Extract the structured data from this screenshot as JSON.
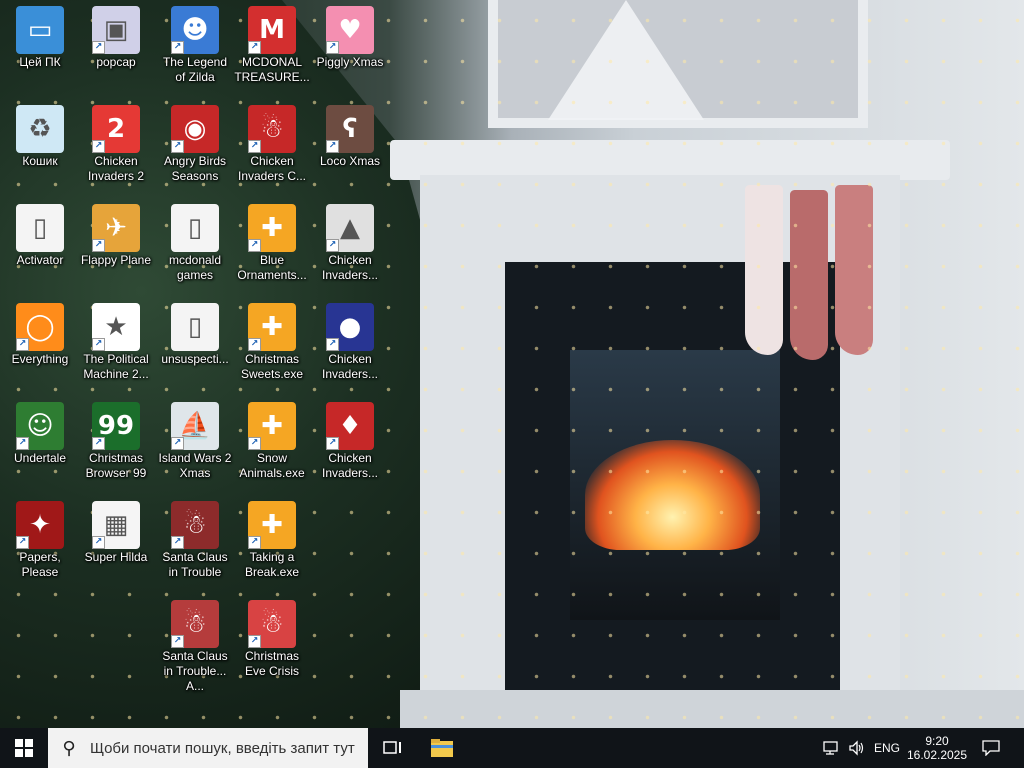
{
  "desktop": {
    "icons": [
      {
        "label": "Цей ПК",
        "icon": "computer-icon",
        "color": "#3a8fd8",
        "glyph": "▭",
        "shortcut": false
      },
      {
        "label": "Кошик",
        "icon": "recycle-bin-icon",
        "color": "#cfe8f5",
        "glyph": "♻",
        "shortcut": false
      },
      {
        "label": "Activator",
        "icon": "file-icon",
        "color": "#f4f4f4",
        "glyph": "▯",
        "shortcut": false
      },
      {
        "label": "Everything",
        "icon": "everything-search-icon",
        "color": "#ff8c1a",
        "glyph": "◯",
        "shortcut": true
      },
      {
        "label": "Undertale",
        "icon": "undertale-icon",
        "color": "#2e7d32",
        "glyph": "☺",
        "shortcut": true
      },
      {
        "label": "Papers, Please",
        "icon": "papers-please-icon",
        "color": "#a01818",
        "glyph": "✦",
        "shortcut": true
      },
      {
        "label": "popcap",
        "icon": "popcap-icon",
        "color": "#d0d0e8",
        "glyph": "▣",
        "shortcut": true
      },
      {
        "label": "Chicken Invaders 2",
        "icon": "chicken-invaders-icon",
        "color": "#e53935",
        "glyph": "2",
        "shortcut": true
      },
      {
        "label": "Flappy Plane",
        "icon": "flappy-plane-icon",
        "color": "#e6a43a",
        "glyph": "✈",
        "shortcut": true
      },
      {
        "label": "The Political Machine 2...",
        "icon": "political-machine-icon",
        "color": "#ffffff",
        "glyph": "★",
        "shortcut": true
      },
      {
        "label": "Christmas Browser 99",
        "icon": "christmas-tree-icon",
        "color": "#1b6e2b",
        "glyph": "99",
        "shortcut": true
      },
      {
        "label": "Super Hilda",
        "icon": "super-hilda-icon",
        "color": "#f5f5f5",
        "glyph": "▦",
        "shortcut": true
      },
      {
        "label": "The Legend of Zilda",
        "icon": "zilda-icon",
        "color": "#3a7bd5",
        "glyph": "☻",
        "shortcut": true
      },
      {
        "label": "Angry Birds Seasons",
        "icon": "angry-birds-icon",
        "color": "#c62828",
        "glyph": "◉",
        "shortcut": true
      },
      {
        "label": "mcdonald games",
        "icon": "file-icon",
        "color": "#f4f4f4",
        "glyph": "▯",
        "shortcut": false
      },
      {
        "label": "unsuspecti...",
        "icon": "file-icon",
        "color": "#f4f4f4",
        "glyph": "▯",
        "shortcut": false
      },
      {
        "label": "Island Wars 2 Xmas",
        "icon": "island-wars-icon",
        "color": "#dfe6ea",
        "glyph": "⛵",
        "shortcut": true
      },
      {
        "label": "Santa Claus in Trouble",
        "icon": "santa-icon",
        "color": "#8d2b2b",
        "glyph": "☃",
        "shortcut": true
      },
      {
        "label": "Santa Claus in Trouble... A...",
        "icon": "santa-icon",
        "color": "#b53c3c",
        "glyph": "☃",
        "shortcut": true
      },
      {
        "label": "MCDONAL TREASURE...",
        "icon": "mcdonalds-icon",
        "color": "#d32f2f",
        "glyph": "M",
        "shortcut": true
      },
      {
        "label": "Chicken Invaders C...",
        "icon": "chicken-invaders-icon",
        "color": "#c62828",
        "glyph": "☃",
        "shortcut": true
      },
      {
        "label": "Blue Ornaments...",
        "icon": "puzzle-exe-icon",
        "color": "#f5a623",
        "glyph": "✚",
        "shortcut": true
      },
      {
        "label": "Christmas Sweets.exe",
        "icon": "puzzle-exe-icon",
        "color": "#f5a623",
        "glyph": "✚",
        "shortcut": true
      },
      {
        "label": "Snow Animals.exe",
        "icon": "puzzle-exe-icon",
        "color": "#f5a623",
        "glyph": "✚",
        "shortcut": true
      },
      {
        "label": "Taking a Break.exe",
        "icon": "puzzle-exe-icon",
        "color": "#f5a623",
        "glyph": "✚",
        "shortcut": true
      },
      {
        "label": "Christmas Eve Crisis",
        "icon": "santa-icon",
        "color": "#d84343",
        "glyph": "☃",
        "shortcut": true
      },
      {
        "label": "Piggly Xmas",
        "icon": "piggly-icon",
        "color": "#f48fb1",
        "glyph": "♥",
        "shortcut": true
      },
      {
        "label": "Loco Xmas",
        "icon": "loco-bear-icon",
        "color": "#6d4c41",
        "glyph": "ʕ",
        "shortcut": true
      },
      {
        "label": "Chicken Invaders...",
        "icon": "chicken-invaders-icon",
        "color": "#e0e0e0",
        "glyph": "▲",
        "shortcut": true
      },
      {
        "label": "Chicken Invaders...",
        "icon": "chicken-invaders-icon",
        "color": "#283593",
        "glyph": "●",
        "shortcut": true
      },
      {
        "label": "Chicken Invaders...",
        "icon": "chicken-invaders-icon",
        "color": "#c62828",
        "glyph": "♦",
        "shortcut": true
      }
    ]
  },
  "taskbar": {
    "search_placeholder": "Щоби почати пошук, введіть запит тут",
    "language": "ENG",
    "time": "9:20",
    "date": "16.02.2025"
  }
}
